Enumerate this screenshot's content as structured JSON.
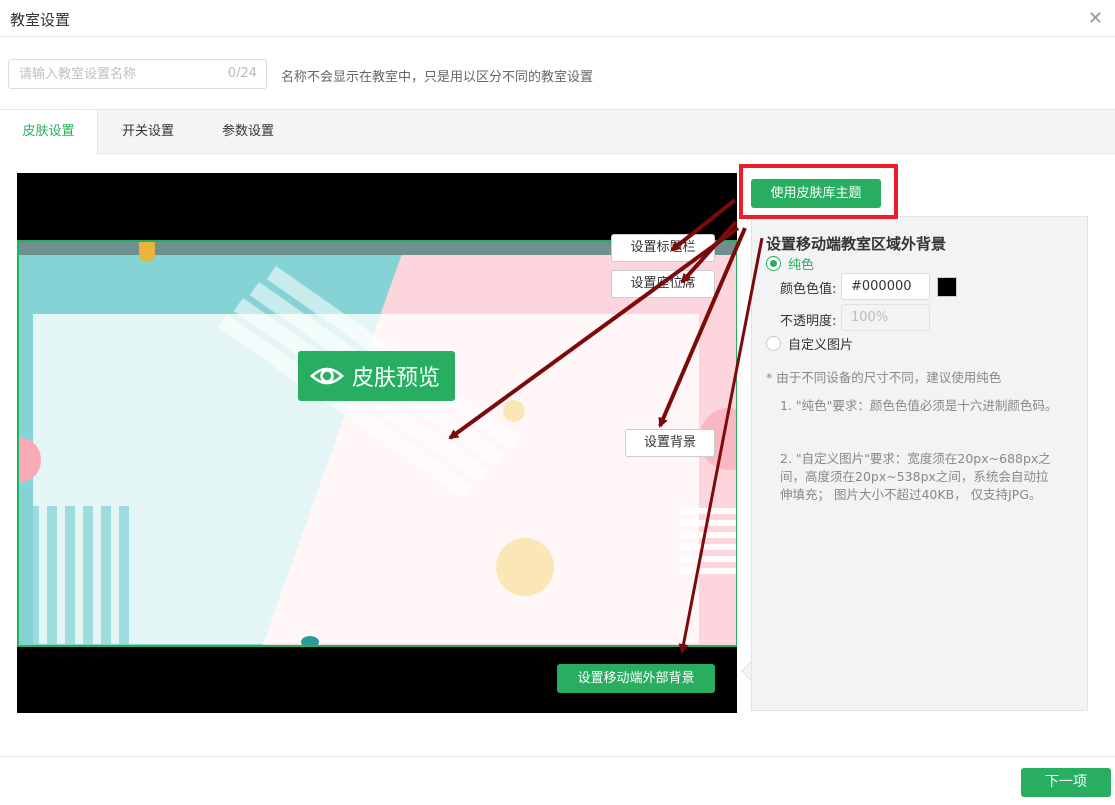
{
  "dialog": {
    "title": "教室设置"
  },
  "name_field": {
    "placeholder": "请输入教室设置名称",
    "value": "",
    "counter": "0/24",
    "hint": "名称不会显示在教室中，只是用以区分不同的教室设置"
  },
  "tabs": [
    {
      "label": "皮肤设置",
      "active": true
    },
    {
      "label": "开关设置",
      "active": false
    },
    {
      "label": "参数设置",
      "active": false
    }
  ],
  "preview": {
    "skin_preview_label": "皮肤预览",
    "set_title_bar_label": "设置标题栏",
    "set_seats_label": "设置座位席",
    "set_background_label": "设置背景",
    "set_mobile_outer_bg_label": "设置移动端外部背景"
  },
  "use_theme_button": "使用皮肤库主题",
  "side_panel": {
    "heading": "设置移动端教室区域外背景",
    "solid_option": "纯色",
    "solid_selected": true,
    "color_label": "颜色色值:",
    "color_value": "#000000",
    "swatch_color": "#000000",
    "opacity_label": "不透明度:",
    "opacity_placeholder": "100%",
    "custom_option": "自定义图片",
    "note": "* 由于不同设备的尺寸不同，建议使用纯色",
    "requirement_1": "1. \"纯色\"要求：颜色色值必须是十六进制颜色码。",
    "requirement_2": "2. \"自定义图片\"要求：宽度须在20px~688px之间，高度须在20px~538px之间，系统会自动拉伸填充； 图片大小不超过40KB， 仅支持JPG。"
  },
  "footer": {
    "next_label": "下一项"
  },
  "colors": {
    "accent": "#27ae60",
    "highlight": "#ef1c2c",
    "arrow": "#7b0a0a"
  }
}
